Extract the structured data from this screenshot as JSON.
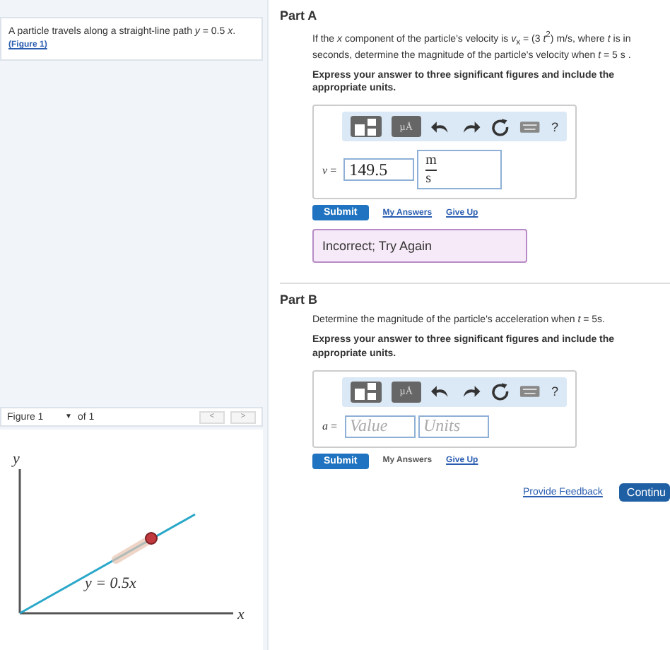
{
  "problem": {
    "text": "A particle travels along a straight-line path *y* = 0.5 *x*.",
    "figure_link": "(Figure 1)"
  },
  "figure": {
    "select": "Figure 1",
    "select_caret": "▼",
    "count": "of 1",
    "prev": "<",
    "next": ">",
    "y_axis": "y",
    "x_axis": "x",
    "line_label": "y = 0.5x"
  },
  "parts": [
    {
      "title": "Part A",
      "question": "If the *x* component of the particle's velocity is *v*$_{x}$ = (3 *t*$^{2}$) m/s, where *t* is in seconds, determine the magnitude of the particle's velocity when *t* = 5 s .",
      "instruction": "Express your answer to three significant figures and include the appropriate units.",
      "toolbar": {
        "units_button": "µÅ",
        "help": "?"
      },
      "variable": "v",
      "equals": "=",
      "value": "149.5",
      "unit_num": "m",
      "unit_den": "s",
      "submit": "Submit",
      "my_answers": {
        "label": "My Answers",
        "disabled": false
      },
      "give_up": "Give Up",
      "feedback": "Incorrect; Try Again"
    },
    {
      "title": "Part B",
      "question": "Determine the magnitude of the particle's acceleration when *t* = 5s.",
      "instruction": "Express your answer to three significant figures and include the appropriate units.",
      "toolbar": {
        "units_button": "µÅ",
        "help": "?"
      },
      "variable": "a",
      "equals": "=",
      "value_placeholder": "Value",
      "units_placeholder": "Units",
      "submit": "Submit",
      "my_answers": {
        "label": "My Answers",
        "disabled": true
      },
      "give_up": "Give Up"
    }
  ],
  "footer": {
    "feedback_link": "Provide Feedback",
    "continue": "Continu"
  }
}
